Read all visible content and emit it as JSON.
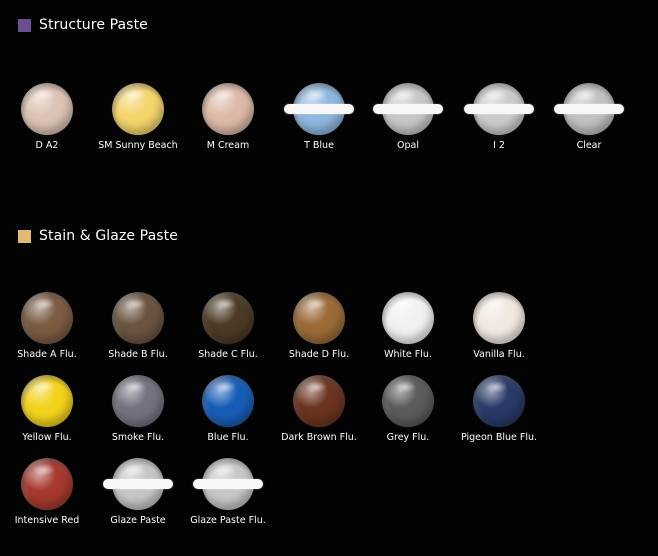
{
  "sections": [
    {
      "title": "Structure Paste",
      "square_color": "#6b4e91",
      "items": [
        {
          "label": "D A2",
          "color": "#dcc3b3"
        },
        {
          "label": "SM Sunny Beach",
          "color": "#f4d56b"
        },
        {
          "label": "M Cream",
          "color": "#ddbaa7"
        },
        {
          "label": "T Blue",
          "color": "#8fb7df",
          "clear_band": true
        },
        {
          "label": "Opal",
          "color": "#c7c7c9",
          "clear_band": true
        },
        {
          "label": "I 2",
          "color": "#cbcbcc",
          "clear_band": true
        },
        {
          "label": "Clear",
          "color": "#c1c1c3",
          "clear_band": true
        }
      ]
    },
    {
      "title": "Stain & Glaze Paste",
      "square_color": "#e3b870",
      "items": [
        {
          "label": "Shade A Flu.",
          "color": "#7b5b42"
        },
        {
          "label": "Shade B Flu.",
          "color": "#6a5441"
        },
        {
          "label": "Shade C Flu.",
          "color": "#4b3a25"
        },
        {
          "label": "Shade D Flu.",
          "color": "#9b6b37"
        },
        {
          "label": "White Flu.",
          "color": "#f1f1f1"
        },
        {
          "label": "Vanilla Flu.",
          "color": "#f2e8e2"
        },
        {
          "label": "Yellow Flu.",
          "color": "#f2d21a"
        },
        {
          "label": "Smoke Flu.",
          "color": "#75717f"
        },
        {
          "label": "Blue Flu.",
          "color": "#175db7"
        },
        {
          "label": "Dark Brown Flu.",
          "color": "#6b3420"
        },
        {
          "label": "Grey Flu.",
          "color": "#5a5b5c"
        },
        {
          "label": "Pigeon Blue Flu.",
          "color": "#293a68"
        },
        {
          "label": "Intensive Red",
          "color": "#a5392e"
        },
        {
          "label": "Glaze Paste",
          "color": "#c6c6c7",
          "clear_band": true
        },
        {
          "label": "Glaze Paste Flu.",
          "color": "#c7c7c8",
          "clear_band": true
        }
      ]
    }
  ]
}
